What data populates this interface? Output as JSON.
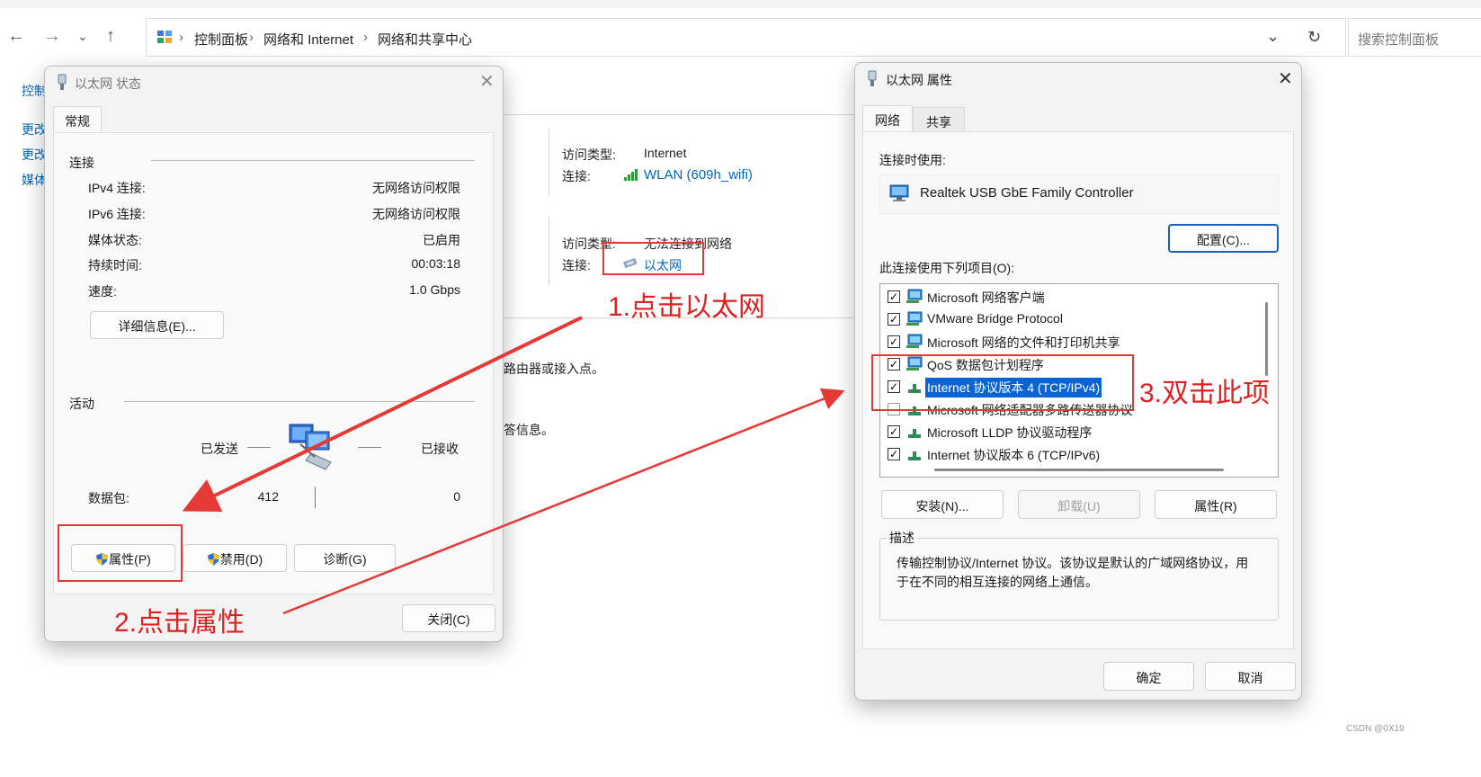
{
  "explorer": {
    "breadcrumb": [
      "控制面板",
      "网络和 Internet",
      "网络和共享中心"
    ],
    "search_placeholder": "搜索控制面板",
    "sidebar": [
      "控制",
      "更改",
      "更改",
      "媒体"
    ],
    "networks": [
      {
        "access_label": "访问类型:",
        "access_value": "Internet",
        "conn_label": "连接:",
        "conn_value": "WLAN (609h_wifi)"
      },
      {
        "access_label": "访问类型:",
        "access_value": "无法连接到网络",
        "conn_label": "连接:",
        "conn_value": "以太网"
      }
    ],
    "partial_texts": [
      "路由器或接入点。",
      "答信息。"
    ]
  },
  "status_dialog": {
    "title": "以太网 状态",
    "tab": "常规",
    "conn_section": "连接",
    "rows": [
      {
        "label": "IPv4 连接:",
        "value": "无网络访问权限"
      },
      {
        "label": "IPv6 连接:",
        "value": "无网络访问权限"
      },
      {
        "label": "媒体状态:",
        "value": "已启用"
      },
      {
        "label": "持续时间:",
        "value": "00:03:18"
      },
      {
        "label": "速度:",
        "value": "1.0 Gbps"
      }
    ],
    "details_button": "详细信息(E)...",
    "activity_section": "活动",
    "sent_label": "已发送",
    "received_label": "已接收",
    "packets_label": "数据包:",
    "packets_sent": "412",
    "packets_received": "0",
    "properties_button": "属性(P)",
    "disable_button": "禁用(D)",
    "diagnose_button": "诊断(G)",
    "close_button": "关闭(C)"
  },
  "props_dialog": {
    "title": "以太网 属性",
    "tabs": [
      "网络",
      "共享"
    ],
    "connect_using_label": "连接时使用:",
    "adapter": "Realtek USB GbE Family Controller",
    "configure_button": "配置(C)...",
    "items_label": "此连接使用下列项目(O):",
    "items": [
      {
        "label": "Microsoft 网络客户端",
        "checked": true,
        "icon": "network-client-icon"
      },
      {
        "label": "VMware Bridge Protocol",
        "checked": true,
        "icon": "network-client-icon"
      },
      {
        "label": "Microsoft 网络的文件和打印机共享",
        "checked": true,
        "icon": "network-client-icon"
      },
      {
        "label": "QoS 数据包计划程序",
        "checked": true,
        "icon": "network-client-icon"
      },
      {
        "label": "Internet 协议版本 4 (TCP/IPv4)",
        "checked": true,
        "selected": true,
        "icon": "protocol-icon"
      },
      {
        "label": "Microsoft 网络适配器多路传送器协议",
        "checked": false,
        "icon": "protocol-icon"
      },
      {
        "label": "Microsoft LLDP 协议驱动程序",
        "checked": true,
        "icon": "protocol-icon"
      },
      {
        "label": "Internet 协议版本 6 (TCP/IPv6)",
        "checked": true,
        "icon": "protocol-icon"
      }
    ],
    "install_button": "安装(N)...",
    "uninstall_button": "卸载(U)",
    "properties_button": "属性(R)",
    "description_label": "描述",
    "description_line1": "传输控制协议/Internet 协议。该协议是默认的广域网络协议，用",
    "description_line2": "于在不同的相互连接的网络上通信。",
    "ok_button": "确定",
    "cancel_button": "取消"
  },
  "annotations": {
    "step1": "1.点击以太网",
    "step2": "2.点击属性",
    "step3": "3.双击此项"
  },
  "watermark": "CSDN @0X19",
  "colors": {
    "link": "#0067c0",
    "annotation": "#e02020",
    "selection": "#0a64d6"
  }
}
